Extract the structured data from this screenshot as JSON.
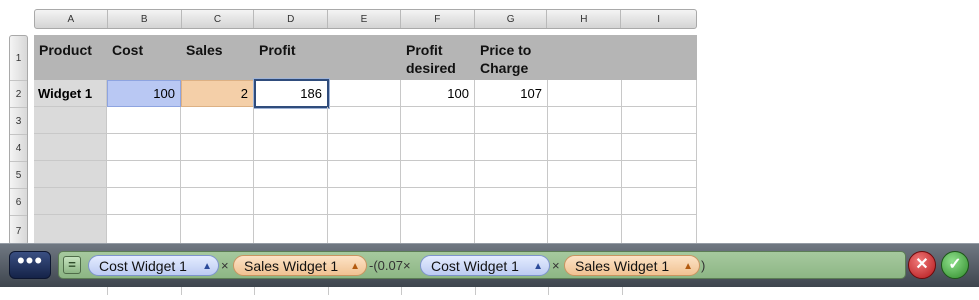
{
  "columns": [
    "A",
    "B",
    "C",
    "D",
    "E",
    "F",
    "G",
    "H",
    "I"
  ],
  "rows": [
    "1",
    "2",
    "3",
    "4",
    "5",
    "6",
    "7"
  ],
  "headers": {
    "A": "Product",
    "B": "Cost",
    "C": "Sales",
    "D": "Profit",
    "E": "",
    "F": "Profit desired",
    "G": "Price to Charge",
    "H": "",
    "I": ""
  },
  "row2": {
    "A": "Widget 1",
    "B": "100",
    "C": "2",
    "D": "186",
    "E": "",
    "F": "100",
    "G": "107",
    "H": "",
    "I": ""
  },
  "formula": {
    "more_label": "•••",
    "equals": "=",
    "token1": "Cost Widget 1",
    "op1": "×",
    "token2": "Sales Widget 1",
    "op2": "-(0.07×",
    "token3": "Cost Widget 1",
    "op3": "×",
    "token4": "Sales Widget 1",
    "close": ")",
    "cancel": "✕",
    "accept": "✓"
  },
  "colors": {
    "cost_ref": "#b9c8f3",
    "sales_ref": "#f4cfa8",
    "formula_bg": "#8db685",
    "header_bg": "#b5b5b5"
  }
}
